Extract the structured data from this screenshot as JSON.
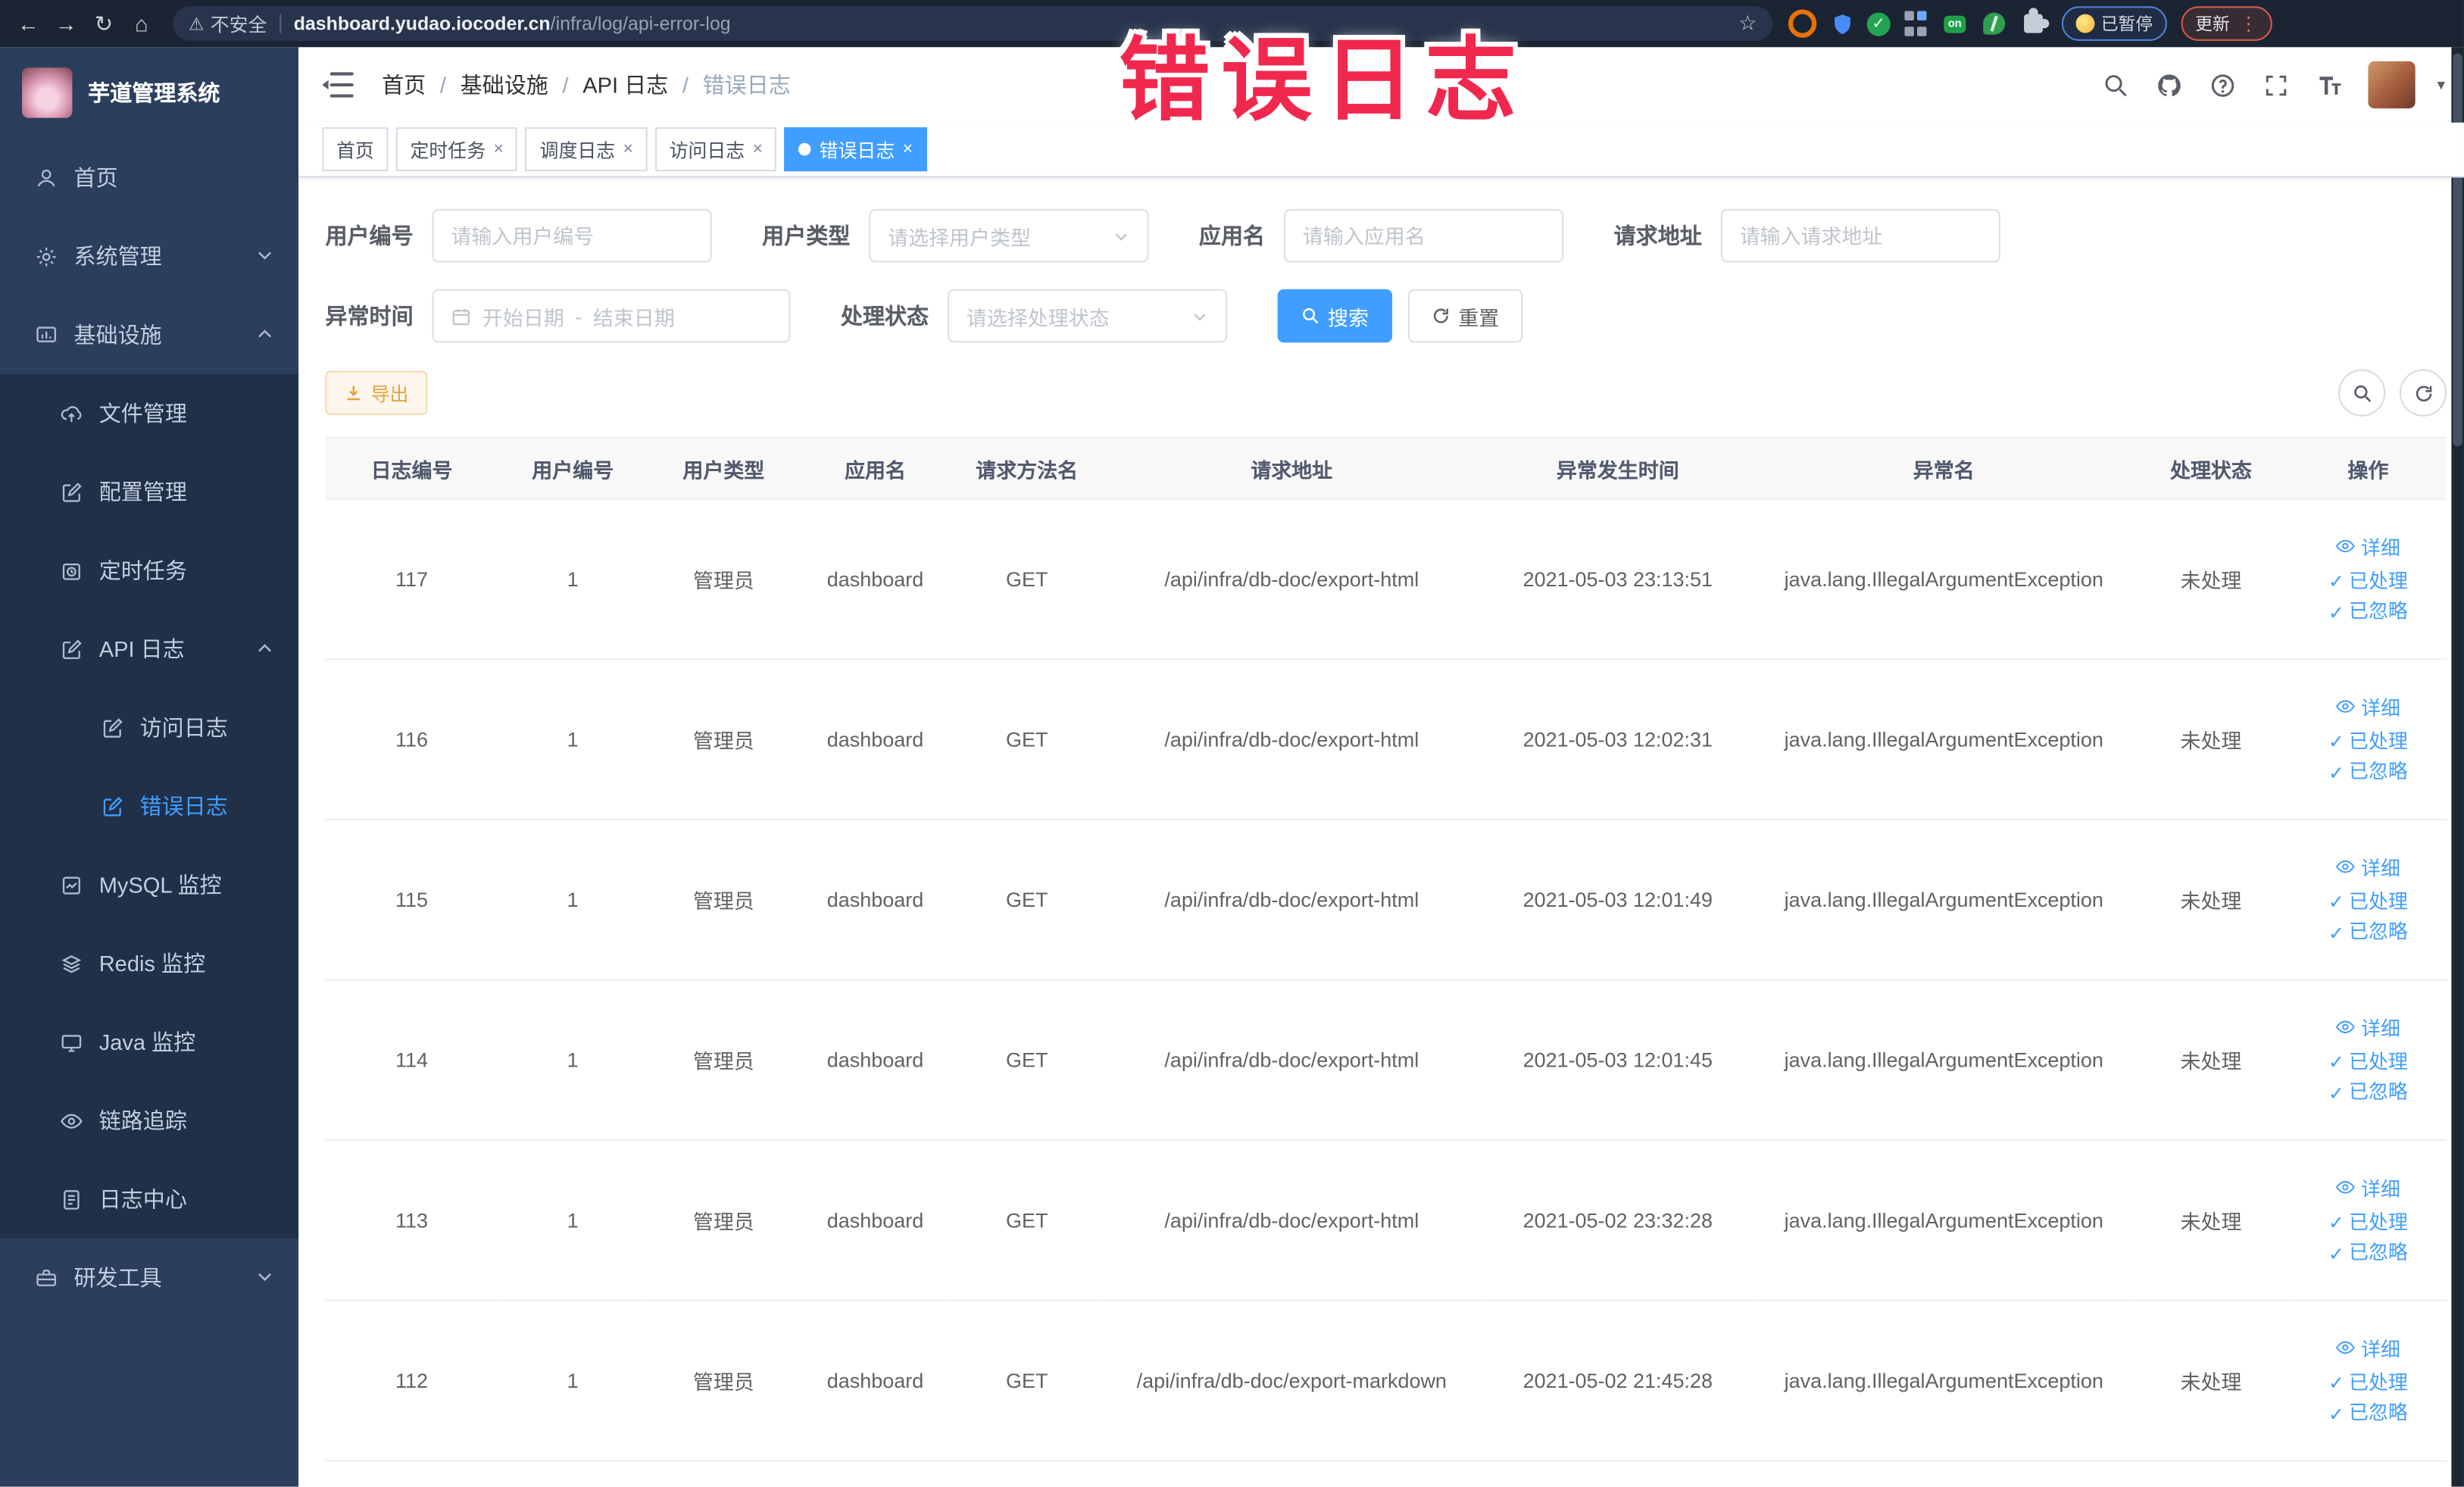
{
  "overlay": {
    "text": "错误日志"
  },
  "browser": {
    "security_label": "不安全",
    "url_domain": "dashboard.yudao.iocoder.cn",
    "url_path": "/infra/log/api-error-log",
    "paused_badge": "已暂停",
    "update_button": "更新"
  },
  "sidebar": {
    "title": "芋道管理系统",
    "menu": [
      {
        "name": "home",
        "label": "首页",
        "icon": "user-icon",
        "level": 1
      },
      {
        "name": "system-management",
        "label": "系统管理",
        "icon": "gear-icon",
        "level": 1,
        "chevron": "down"
      },
      {
        "name": "infrastructure",
        "label": "基础设施",
        "icon": "infra-icon",
        "level": 1,
        "chevron": "up"
      },
      {
        "name": "file-management",
        "label": "文件管理",
        "icon": "cloud-upload-icon",
        "level": 2
      },
      {
        "name": "config-management",
        "label": "配置管理",
        "icon": "edit-icon",
        "level": 2
      },
      {
        "name": "scheduled-tasks",
        "label": "定时任务",
        "icon": "timer-icon",
        "level": 2
      },
      {
        "name": "api-log",
        "label": "API 日志",
        "icon": "edit-icon",
        "level": 2,
        "chevron": "up"
      },
      {
        "name": "access-log",
        "label": "访问日志",
        "icon": "edit-icon",
        "level": 3
      },
      {
        "name": "error-log",
        "label": "错误日志",
        "icon": "edit-icon",
        "level": 3,
        "active": true
      },
      {
        "name": "mysql-monitor",
        "label": "MySQL 监控",
        "icon": "chart-icon",
        "level": 2
      },
      {
        "name": "redis-monitor",
        "label": "Redis 监控",
        "icon": "layers-icon",
        "level": 2
      },
      {
        "name": "java-monitor",
        "label": "Java 监控",
        "icon": "monitor-icon",
        "level": 2
      },
      {
        "name": "trace",
        "label": "链路追踪",
        "icon": "eye-icon",
        "level": 2
      },
      {
        "name": "log-center",
        "label": "日志中心",
        "icon": "log-icon",
        "level": 2
      },
      {
        "name": "dev-tools",
        "label": "研发工具",
        "icon": "toolbox-icon",
        "level": 1,
        "chevron": "down"
      }
    ]
  },
  "header": {
    "breadcrumb": [
      "首页",
      "基础设施",
      "API 日志",
      "错误日志"
    ]
  },
  "tabs": [
    {
      "name": "home",
      "label": "首页",
      "closable": false,
      "active": false
    },
    {
      "name": "scheduled-tasks",
      "label": "定时任务",
      "closable": true,
      "active": false
    },
    {
      "name": "schedule-log",
      "label": "调度日志",
      "closable": true,
      "active": false
    },
    {
      "name": "access-log",
      "label": "访问日志",
      "closable": true,
      "active": false
    },
    {
      "name": "error-log",
      "label": "错误日志",
      "closable": true,
      "active": true
    }
  ],
  "filters": {
    "user_id": {
      "label": "用户编号",
      "placeholder": "请输入用户编号"
    },
    "user_type": {
      "label": "用户类型",
      "placeholder": "请选择用户类型"
    },
    "app_name": {
      "label": "应用名",
      "placeholder": "请输入应用名"
    },
    "request_url": {
      "label": "请求地址",
      "placeholder": "请输入请求地址"
    },
    "exception_time": {
      "label": "异常时间",
      "start_placeholder": "开始日期",
      "separator": "-",
      "end_placeholder": "结束日期"
    },
    "process_status": {
      "label": "处理状态",
      "placeholder": "请选择处理状态"
    },
    "search_button": "搜索",
    "reset_button": "重置"
  },
  "toolbar": {
    "export_button": "导出"
  },
  "table": {
    "headers": [
      "日志编号",
      "用户编号",
      "用户类型",
      "应用名",
      "请求方法名",
      "请求地址",
      "异常发生时间",
      "异常名",
      "处理状态",
      "操作"
    ],
    "actions": [
      "详细",
      "已处理",
      "已忽略"
    ],
    "rows": [
      {
        "id": "117",
        "user_id": "1",
        "user_type": "管理员",
        "app": "dashboard",
        "method": "GET",
        "url": "/api/infra/db-doc/export-html",
        "time": "2021-05-03 23:13:51",
        "exception": "java.lang.IllegalArgumentException",
        "status": "未处理"
      },
      {
        "id": "116",
        "user_id": "1",
        "user_type": "管理员",
        "app": "dashboard",
        "method": "GET",
        "url": "/api/infra/db-doc/export-html",
        "time": "2021-05-03 12:02:31",
        "exception": "java.lang.IllegalArgumentException",
        "status": "未处理"
      },
      {
        "id": "115",
        "user_id": "1",
        "user_type": "管理员",
        "app": "dashboard",
        "method": "GET",
        "url": "/api/infra/db-doc/export-html",
        "time": "2021-05-03 12:01:49",
        "exception": "java.lang.IllegalArgumentException",
        "status": "未处理"
      },
      {
        "id": "114",
        "user_id": "1",
        "user_type": "管理员",
        "app": "dashboard",
        "method": "GET",
        "url": "/api/infra/db-doc/export-html",
        "time": "2021-05-03 12:01:45",
        "exception": "java.lang.IllegalArgumentException",
        "status": "未处理"
      },
      {
        "id": "113",
        "user_id": "1",
        "user_type": "管理员",
        "app": "dashboard",
        "method": "GET",
        "url": "/api/infra/db-doc/export-html",
        "time": "2021-05-02 23:32:28",
        "exception": "java.lang.IllegalArgumentException",
        "status": "未处理"
      },
      {
        "id": "112",
        "user_id": "1",
        "user_type": "管理员",
        "app": "dashboard",
        "method": "GET",
        "url": "/api/infra/db-doc/export-markdown",
        "time": "2021-05-02 21:45:28",
        "exception": "java.lang.IllegalArgumentException",
        "status": "未处理"
      }
    ]
  },
  "colors": {
    "primary": "#409eff",
    "warning": "#e6a23c",
    "sidebar_bg": "#2b3e5c",
    "submenu_bg": "#203048",
    "active_tab": "#409eff",
    "overlay_red": "#f0284e"
  }
}
